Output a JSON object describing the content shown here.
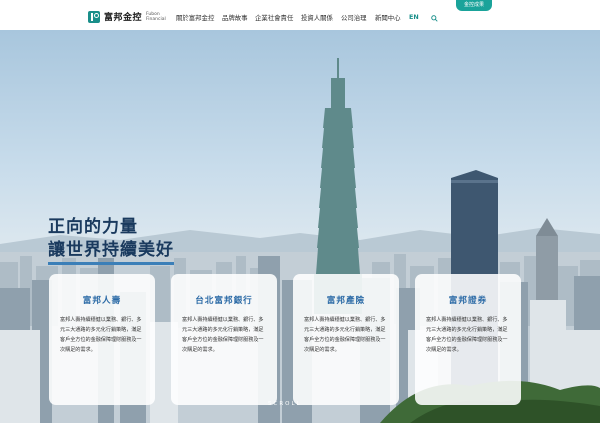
{
  "header": {
    "badge": "金控成果",
    "logo": {
      "name_zh": "富邦金控",
      "name_en": "Fubon Financial"
    },
    "nav": [
      "關於富邦金控",
      "品牌故事",
      "企業社會責任",
      "投資人關係",
      "公司治理",
      "新聞中心",
      "EN"
    ],
    "search_icon": "search-icon"
  },
  "hero": {
    "headline_line1": "正向的力量",
    "headline_line2": "讓世界持續美好",
    "scroll_label": "SCROLL"
  },
  "cards": [
    {
      "title": "富邦人壽",
      "text": "富邦人壽持續穩健以業務、銀行、多元三大通路的多元化行銷策略，滿足客戶全方位的金融保障理財服務及一次購足的需求。"
    },
    {
      "title": "台北富邦銀行",
      "text": "富邦人壽持續穩健以業務、銀行、多元三大通路的多元化行銷策略，滿足客戶全方位的金融保障理財服務及一次購足的需求。"
    },
    {
      "title": "富邦產險",
      "text": "富邦人壽持續穩健以業務、銀行、多元三大通路的多元化行銷策略，滿足客戶全方位的金融保障理財服務及一次購足的需求。"
    },
    {
      "title": "富邦證券",
      "text": "富邦人壽持續穩健以業務、銀行、多元三大通路的多元化行銷策略，滿足客戶全方位的金融保障理財服務及一次購足的需求。"
    }
  ],
  "colors": {
    "brand": "#1a8f8a",
    "accent": "#2b6aa6",
    "headline": "#1a3a5e"
  }
}
